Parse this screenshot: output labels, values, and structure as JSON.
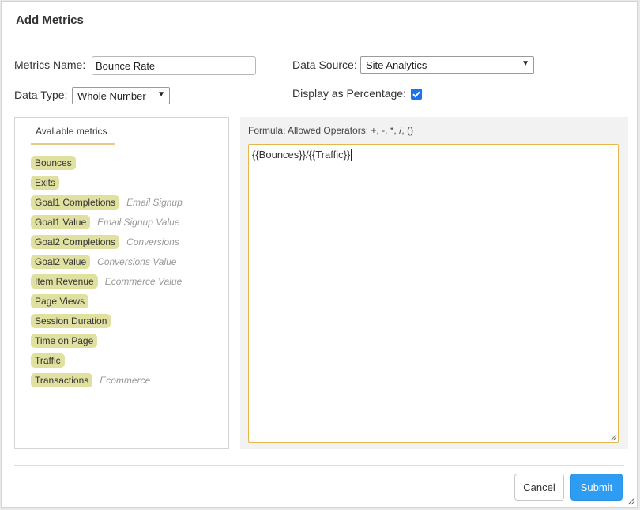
{
  "dialog": {
    "title": "Add Metrics"
  },
  "form": {
    "metrics_name_label": "Metrics Name:",
    "metrics_name_value": "Bounce Rate",
    "data_source_label": "Data Source:",
    "data_source_value": "Site Analytics",
    "data_type_label": "Data Type:",
    "data_type_value": "Whole Number",
    "display_percentage_label": "Display as Percentage:",
    "display_percentage_checked": true
  },
  "metrics_panel": {
    "tab_label": "Avaliable metrics",
    "items": [
      {
        "name": "Bounces",
        "alias": ""
      },
      {
        "name": "Exits",
        "alias": ""
      },
      {
        "name": "Goal1 Completions",
        "alias": "Email Signup"
      },
      {
        "name": "Goal1 Value",
        "alias": "Email Signup Value"
      },
      {
        "name": "Goal2 Completions",
        "alias": "Conversions"
      },
      {
        "name": "Goal2 Value",
        "alias": "Conversions Value"
      },
      {
        "name": "Item Revenue",
        "alias": "Ecommerce Value"
      },
      {
        "name": "Page Views",
        "alias": ""
      },
      {
        "name": "Session Duration",
        "alias": ""
      },
      {
        "name": "Time on Page",
        "alias": ""
      },
      {
        "name": "Traffic",
        "alias": ""
      },
      {
        "name": "Transactions",
        "alias": "Ecommerce"
      }
    ]
  },
  "formula": {
    "caption": "Formula: Allowed Operators: +, -, *, /, ()",
    "value": "{{Bounces}}/{{Traffic}}"
  },
  "footer": {
    "cancel_label": "Cancel",
    "submit_label": "Submit"
  },
  "colors": {
    "chip": "#e0e0a0",
    "accent_border": "#e2b84a",
    "submit": "#2e9cf2",
    "checkbox": "#1a73e8"
  }
}
